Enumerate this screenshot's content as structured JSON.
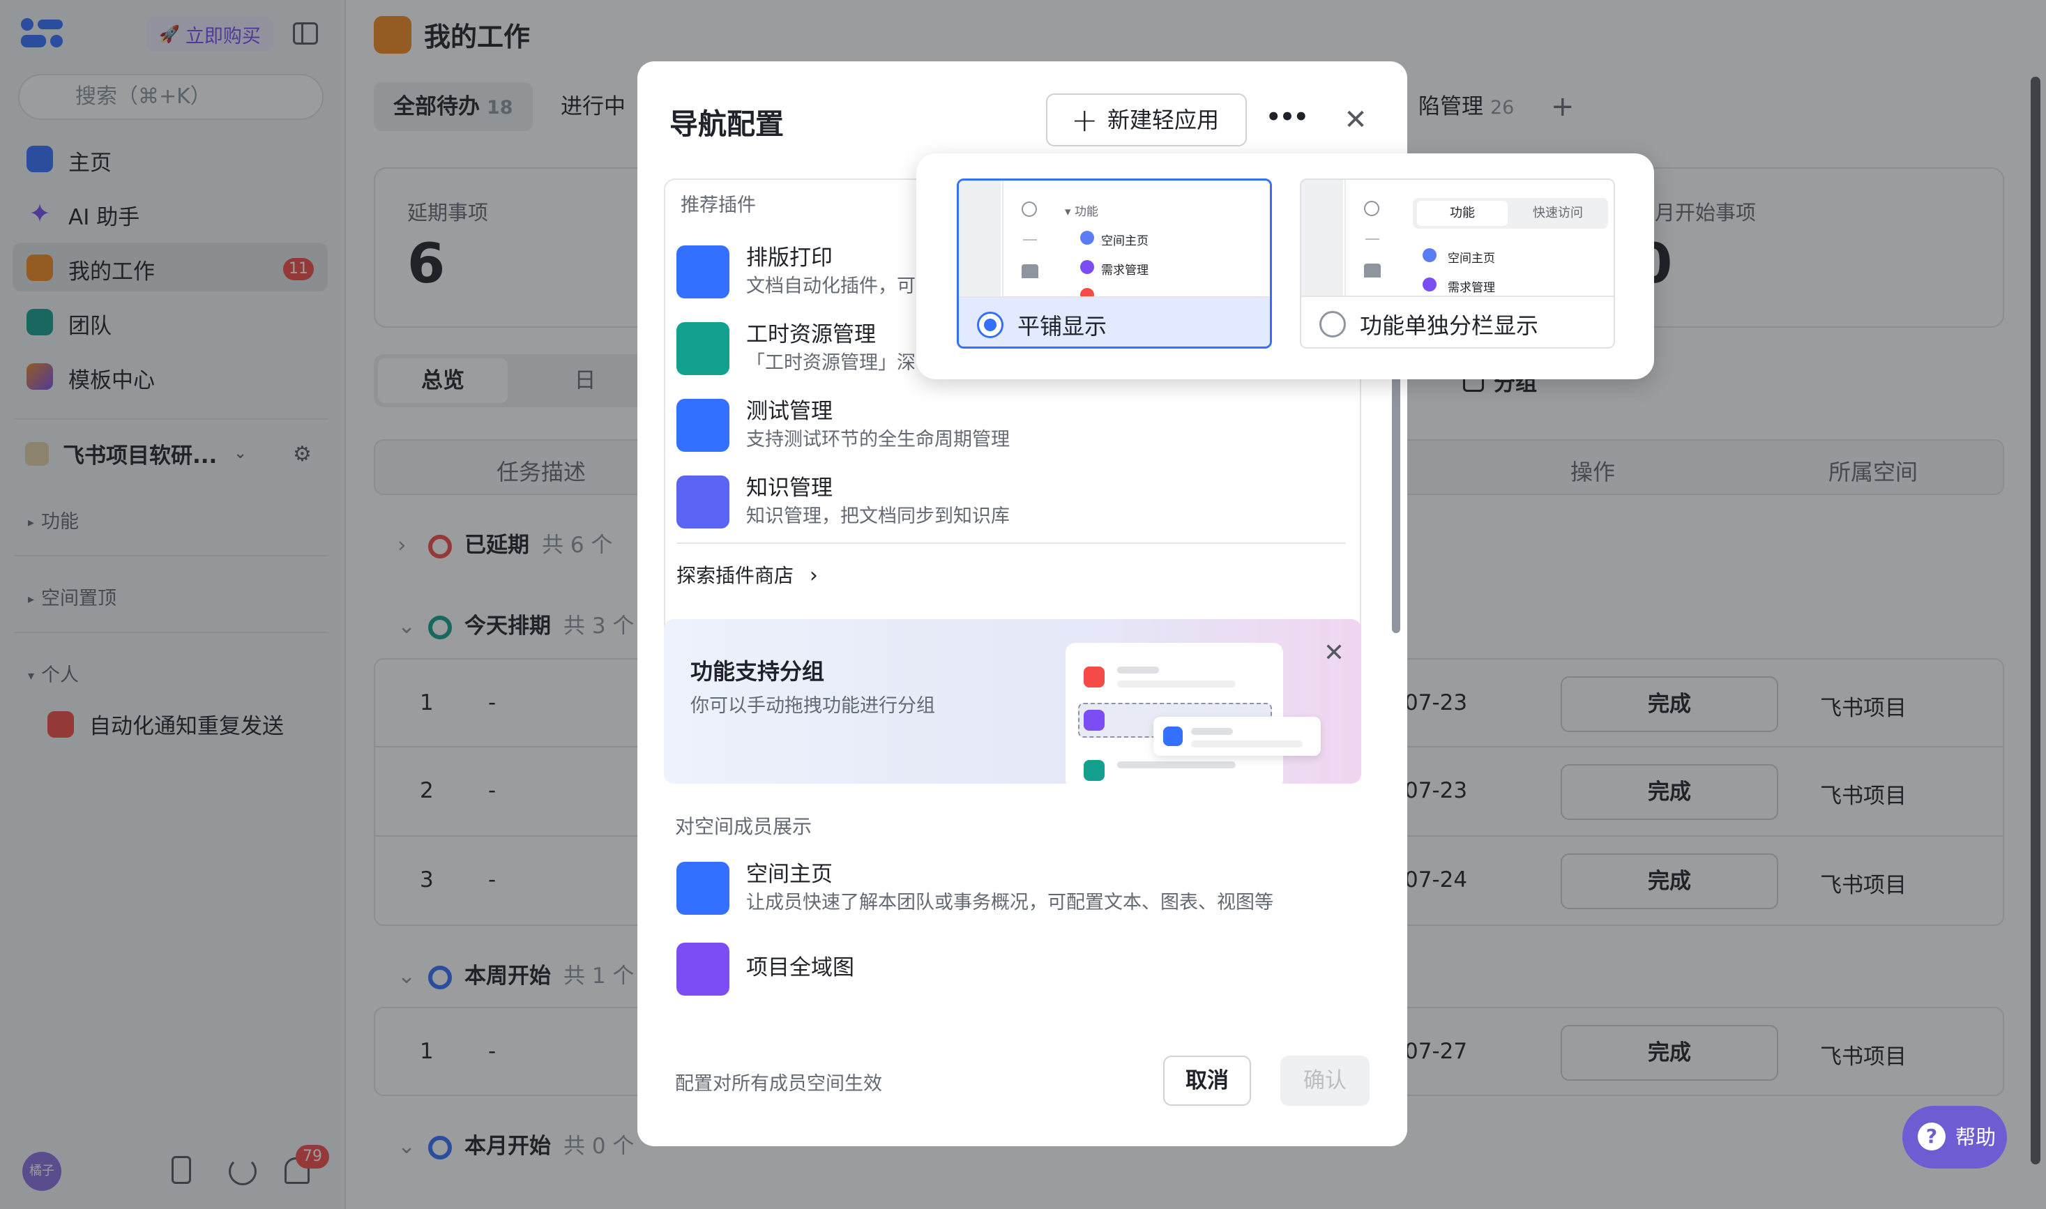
{
  "sidebar": {
    "buy_label": "立即购买",
    "search_placeholder": "搜索（⌘+K）",
    "items": [
      {
        "label": "主页",
        "icon": "home-icon",
        "color": "#3370ff"
      },
      {
        "label": "AI 助手",
        "icon": "sparkle-icon",
        "color": "#7b4df2"
      },
      {
        "label": "我的工作",
        "icon": "person-icon",
        "color": "#f4891f",
        "badge": "11"
      },
      {
        "label": "团队",
        "icon": "team-icon",
        "color": "#14a08e"
      },
      {
        "label": "模板中心",
        "icon": "template-icon",
        "color": "#f54a45"
      }
    ],
    "workspace": "飞书项目软研...",
    "sections": {
      "func": "功能",
      "pinned": "空间置顶",
      "personal": "个人"
    },
    "personal_item": "自动化通知重复发送",
    "avatar_text": "橘子",
    "notif_count": "79"
  },
  "main": {
    "title": "我的工作",
    "tabs": [
      {
        "label": "全部待办",
        "count": "18"
      },
      {
        "label": "进行中",
        "count": ""
      },
      {
        "label": "陷管理",
        "count": "26"
      }
    ],
    "cards": [
      {
        "title": "延期事项",
        "value": "6"
      },
      {
        "title": "本月开始事项",
        "value": "0"
      }
    ],
    "seg": {
      "overview": "总览",
      "day": "日"
    },
    "group_toggle": "分组",
    "headers": {
      "desc": "任务描述",
      "op": "操作",
      "space": "所属空间"
    },
    "groups": [
      {
        "label": "已延期",
        "count": "共 6 个"
      },
      {
        "label": "今天排期",
        "count": "共 3 个"
      },
      {
        "label": "本周开始",
        "count": "共 1 个"
      },
      {
        "label": "本月开始",
        "count": "共 0 个"
      }
    ],
    "rows": [
      {
        "n": "1",
        "d": "-",
        "date": "07-23",
        "op": "完成",
        "space": "飞书项目"
      },
      {
        "n": "2",
        "d": "-",
        "date": "07-23",
        "op": "完成",
        "space": "飞书项目"
      },
      {
        "n": "3",
        "d": "-",
        "date": "07-24",
        "op": "完成",
        "space": "飞书项目"
      },
      {
        "n": "1",
        "d": "-",
        "date": "07-27",
        "op": "完成",
        "space": "飞书项目"
      }
    ]
  },
  "dialog": {
    "title": "导航配置",
    "new_app": "新建轻应用",
    "more": "•••",
    "recommended": "推荐插件",
    "plugins": [
      {
        "name": "排版打印",
        "desc": "文档自动化插件，可",
        "color": "#3370ff"
      },
      {
        "name": "工时资源管理",
        "desc": "「工时资源管理」深",
        "color": "#14a08e"
      },
      {
        "name": "测试管理",
        "desc": "支持测试环节的全生命周期管理",
        "color": "#3370ff"
      },
      {
        "name": "知识管理",
        "desc": "知识管理，把文档同步到知识库",
        "color": "#5b65f5"
      }
    ],
    "explore": "探索插件商店",
    "banner_title": "功能支持分组",
    "banner_desc": "你可以手动拖拽功能进行分组",
    "member_head": "对空间成员展示",
    "members": [
      {
        "name": "空间主页",
        "desc": "让成员快速了解本团队或事务概况，可配置文本、图表、视图等",
        "color": "#3370ff"
      },
      {
        "name": "项目全域图",
        "desc": "",
        "color": "#7b4df2"
      }
    ],
    "footer_note": "配置对所有成员空间生效",
    "cancel": "取消",
    "confirm": "确认"
  },
  "popover": {
    "opt1": {
      "label": "平铺显示",
      "mini": [
        "功能",
        "空间主页",
        "需求管理"
      ]
    },
    "opt2": {
      "label": "功能单独分栏显示",
      "tabs": [
        "功能",
        "快速访问"
      ],
      "mini": [
        "空间主页",
        "需求管理"
      ]
    }
  },
  "help": "帮助"
}
